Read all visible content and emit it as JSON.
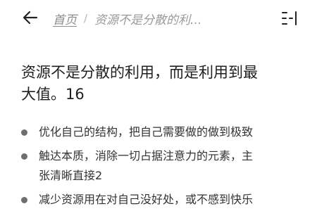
{
  "nav": {
    "home_label": "首页",
    "separator": "/",
    "current_label": "资源不是分散的利..."
  },
  "icons": {
    "back": "back-arrow-icon",
    "toc": "table-of-contents-icon"
  },
  "article": {
    "title_line1": "资源不是分散的利用，而是利用到最",
    "title_line2": "大值。16",
    "list": [
      {
        "line1": "优化自己的结构，把自己需要做的做到极致",
        "line2": ""
      },
      {
        "line1": "触达本质，消除一切占据注意力的元素，主",
        "line2": "张清晰直接2"
      },
      {
        "line1": "减少资源用在对自己没好处，或不感到快乐",
        "line2": ""
      }
    ]
  },
  "colors": {
    "text": "#222222",
    "muted": "#9a9a9a",
    "bullet": "#6e6e6e",
    "background": "#ffffff"
  }
}
